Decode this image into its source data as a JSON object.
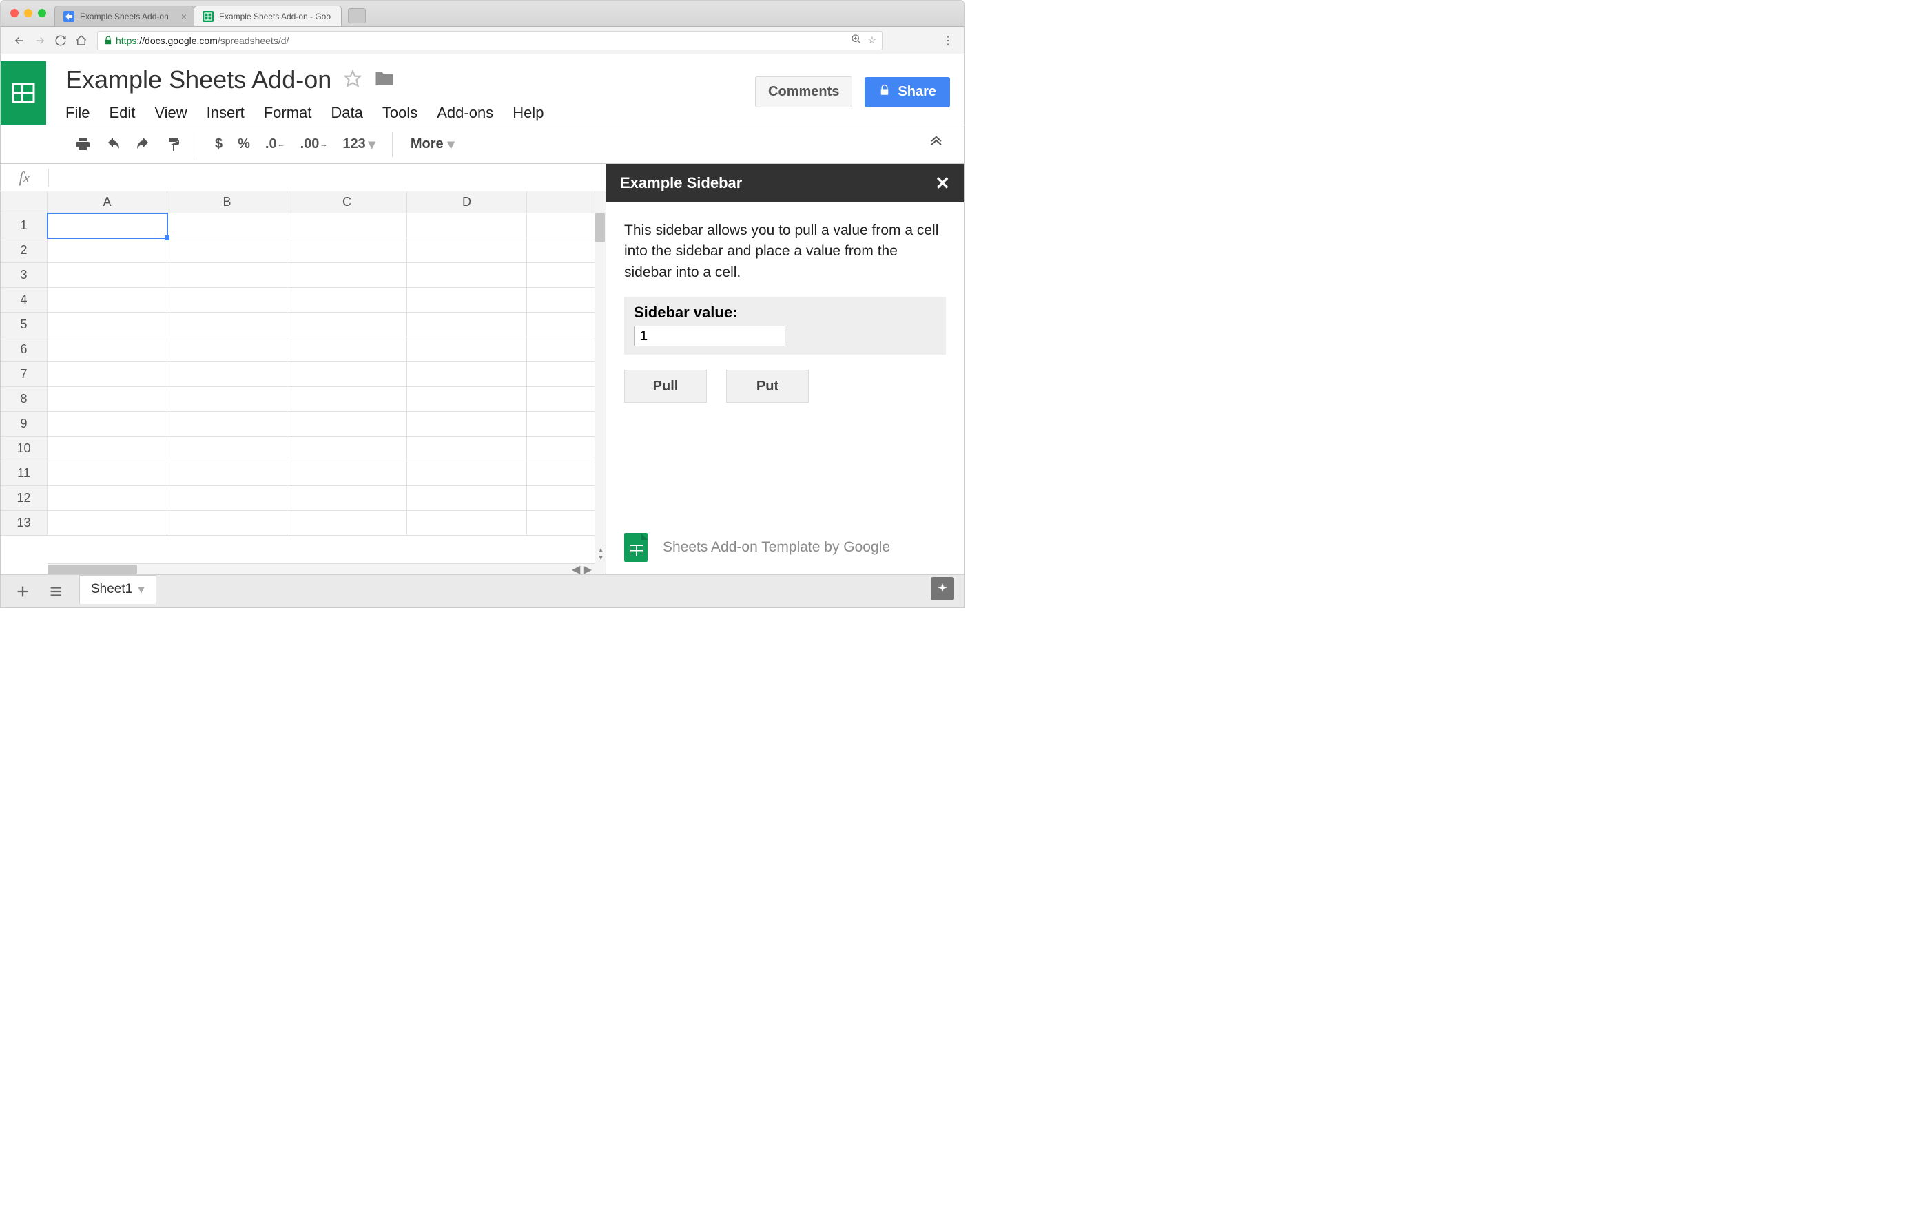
{
  "browser": {
    "tabs": [
      {
        "label": "Example Sheets Add-on",
        "active": false
      },
      {
        "label": "Example Sheets Add-on - Goo",
        "active": true
      }
    ],
    "urlPrefix": "https",
    "urlHost": "://docs.google.com",
    "urlPath": "/spreadsheets/d/"
  },
  "doc": {
    "title": "Example Sheets Add-on",
    "menus": [
      "File",
      "Edit",
      "View",
      "Insert",
      "Format",
      "Data",
      "Tools",
      "Add-ons",
      "Help"
    ],
    "commentsBtn": "Comments",
    "shareBtn": "Share"
  },
  "toolbar": {
    "currency": "$",
    "percent": "%",
    "decDec": ".0",
    "incDec": ".00",
    "numFmt": "123",
    "more": "More"
  },
  "sidebar": {
    "title": "Example Sidebar",
    "description": "This sidebar allows you to pull a value from a cell into the sidebar and place a value from the sidebar into a cell.",
    "valueLabel": "Sidebar value:",
    "value": "1",
    "pull": "Pull",
    "put": "Put",
    "footer": "Sheets Add-on Template by Google"
  },
  "fx": {
    "label": "fx",
    "value": ""
  },
  "columns": [
    "A",
    "B",
    "C",
    "D",
    ""
  ],
  "rows": [
    "1",
    "2",
    "3",
    "4",
    "5",
    "6",
    "7",
    "8",
    "9",
    "10",
    "11",
    "12",
    "13"
  ],
  "selectedCell": {
    "row": 0,
    "col": 0
  },
  "sheetTab": "Sheet1"
}
